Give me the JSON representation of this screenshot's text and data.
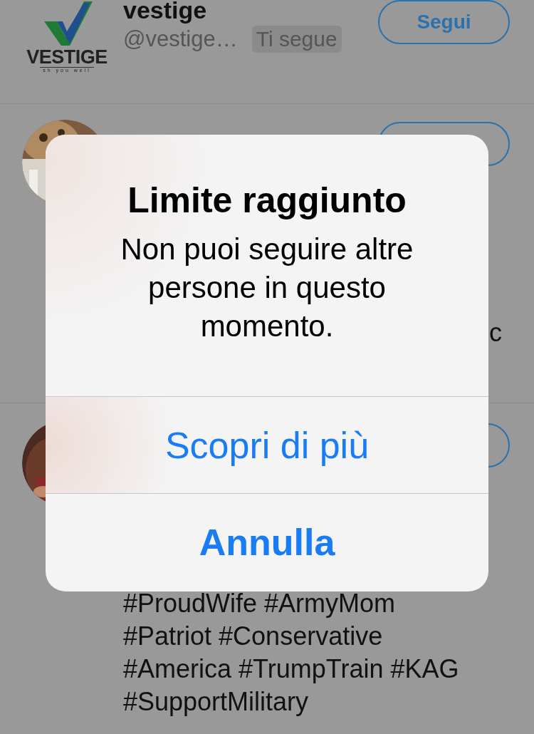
{
  "users": [
    {
      "name": "vestige",
      "handle": "@vestige…",
      "badge": "Ti segue",
      "follow_button": true,
      "follow_label": "Segui",
      "avatar": {
        "kind": "logo",
        "wordmark": "VESTIGE",
        "tagline": "sh you well"
      }
    },
    {
      "follow_button": true,
      "avatar": {
        "kind": "picture"
      },
      "bio": [
        "c"
      ]
    },
    {
      "follow_button": true,
      "avatar": {
        "kind": "picture"
      },
      "bio": [
        "#ProudWife #ArmyMom",
        "#Patriot #Conservative",
        "#America #TrumpTrain #KAG",
        "#SupportMilitary"
      ]
    }
  ],
  "dialog": {
    "title": "Limite raggiunto",
    "message": "Non puoi seguire altre persone in questo momento.",
    "actions": [
      {
        "label": "Scopri di più",
        "kind": "default"
      },
      {
        "label": "Annulla",
        "kind": "cancel"
      }
    ]
  }
}
